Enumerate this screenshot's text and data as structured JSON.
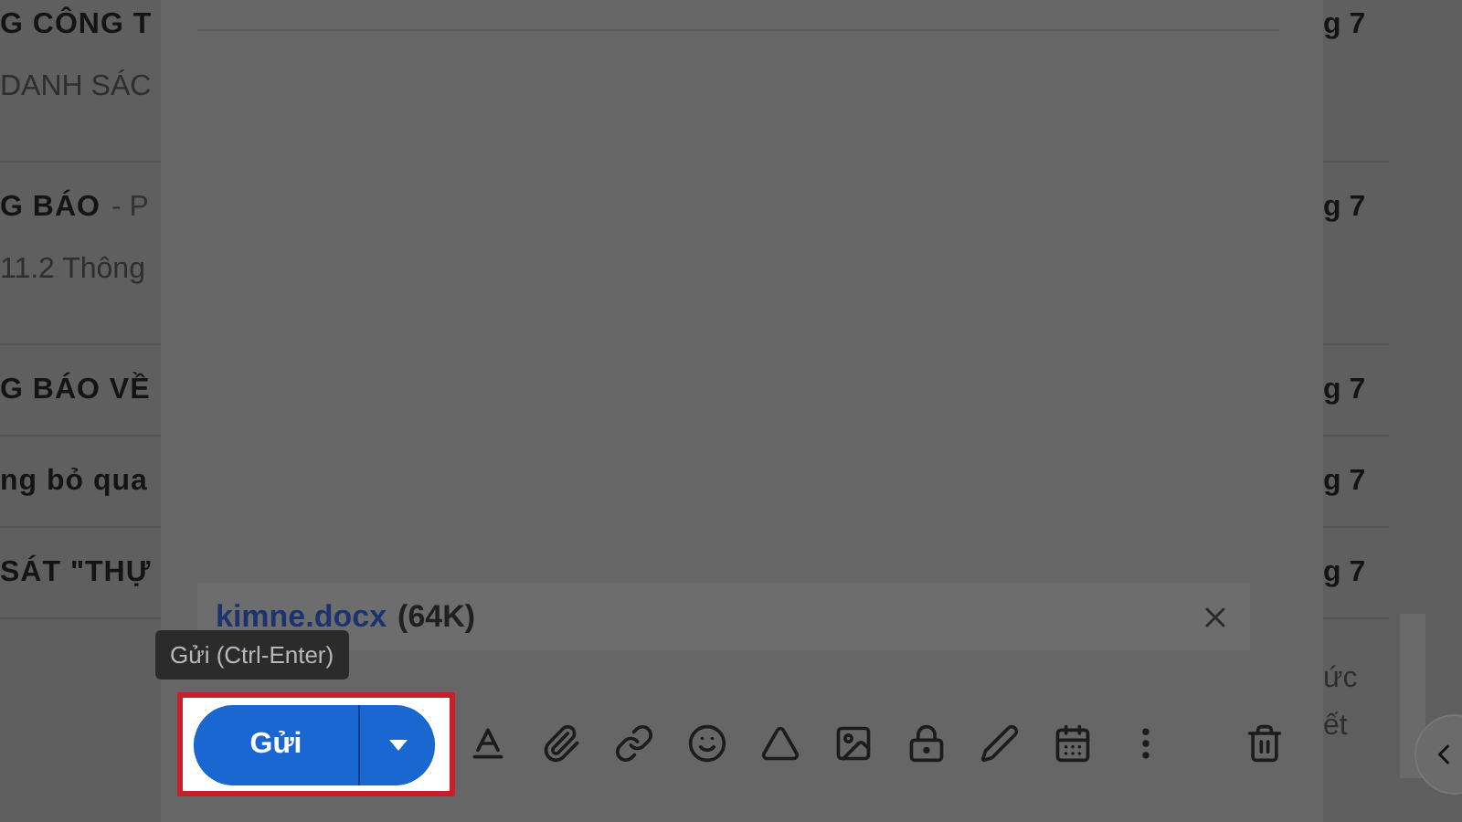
{
  "inbox_rows": [
    {
      "subject": "G CÔNG T",
      "suffix": "",
      "snippet": "DANH SÁC",
      "date": "g 7",
      "unread": true
    },
    {
      "subject": "G BÁO",
      "suffix": "- P",
      "snippet": "11.2 Thông",
      "date": "g 7",
      "unread": true
    },
    {
      "subject": "G BÁO VỀ",
      "suffix": "",
      "snippet": "",
      "date": "g 7",
      "unread": true
    },
    {
      "subject": "ng bỏ qua",
      "suffix": "",
      "snippet": "",
      "date": "g 7",
      "unread": true
    },
    {
      "subject": "SÁT \"THỰ",
      "suffix": "",
      "snippet": "",
      "date": "g 7",
      "unread": true
    }
  ],
  "right_snippet": [
    "ức",
    "ết"
  ],
  "compose": {
    "attachment": {
      "name": "kimne.docx",
      "size": "(64K)"
    },
    "tooltip": "Gửi (Ctrl-Enter)",
    "send_button": {
      "label": "Gửi",
      "highlighted": true
    }
  }
}
